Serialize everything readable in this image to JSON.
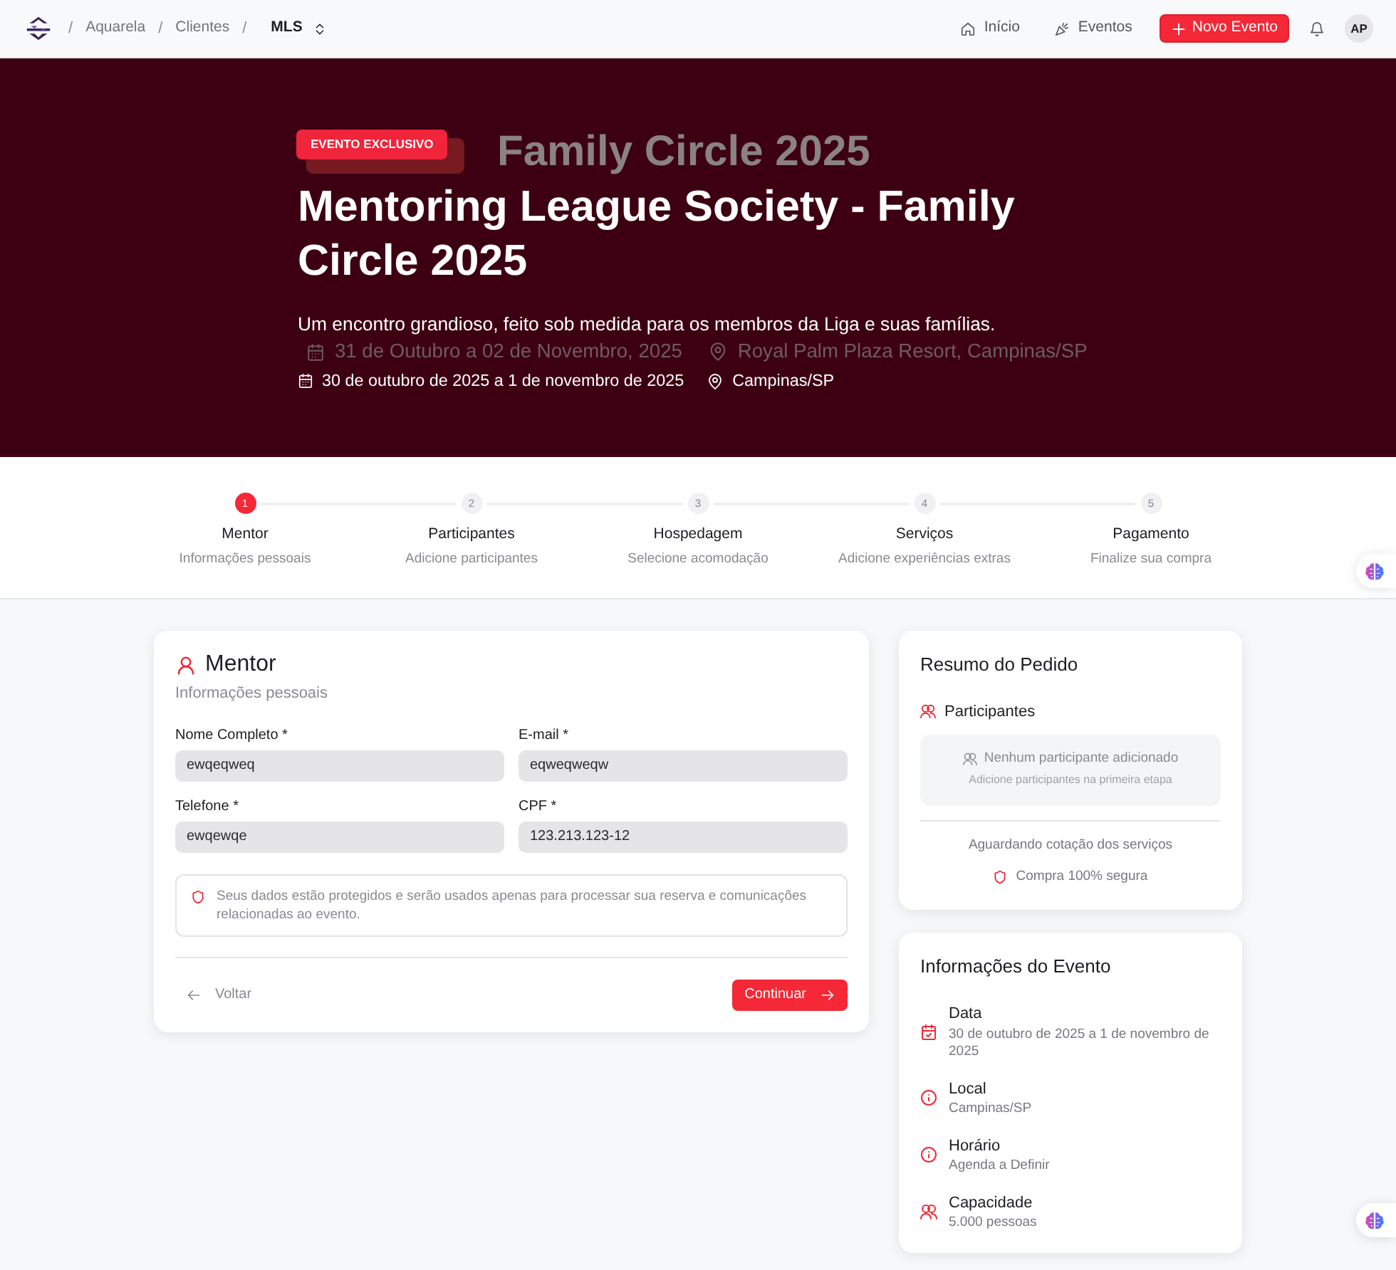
{
  "navbar": {
    "breadcrumb": [
      {
        "kind": "separator",
        "text": "/"
      },
      {
        "kind": "link",
        "text": "Aquarela"
      },
      {
        "kind": "separator",
        "text": "/"
      },
      {
        "kind": "link",
        "text": "Clientes"
      },
      {
        "kind": "separator",
        "text": "/"
      },
      {
        "kind": "current",
        "text": "MLS"
      }
    ],
    "links": [
      {
        "kind": "home",
        "label": "Início"
      },
      {
        "kind": "party",
        "label": "Eventos"
      }
    ],
    "new_button": "Novo Evento",
    "avatar": "AP"
  },
  "hero": {
    "badge": "EVENTO EXCLUSIVO",
    "title": "Mentoring League Society - Family Circle 2025",
    "subtitle": "Um encontro grandioso, feito sob medida para os membros da Liga e suas famílias.",
    "date": "30 de outubro de 2025 a 1 de novembro de 2025",
    "location": "Campinas/SP",
    "previous_slide": {
      "badge": true,
      "title": "Family Circle 2025",
      "date": "31 de Outubro a 02 de Novembro, 2025",
      "location": "Royal Palm Plaza Resort, Campinas/SP"
    }
  },
  "stepper": {
    "steps": [
      {
        "number": "1",
        "title": "Mentor",
        "subtitle": "Informações pessoais",
        "active": true
      },
      {
        "number": "2",
        "title": "Participantes",
        "subtitle": "Adicione participantes",
        "active": false
      },
      {
        "number": "3",
        "title": "Hospedagem",
        "subtitle": "Selecione acomodação",
        "active": false
      },
      {
        "number": "4",
        "title": "Serviços",
        "subtitle": "Adicione experiências extras",
        "active": false
      },
      {
        "number": "5",
        "title": "Pagamento",
        "subtitle": "Finalize sua compra",
        "active": false
      }
    ]
  },
  "form": {
    "title": "Mentor",
    "subtitle": "Informações pessoais",
    "fields": [
      {
        "label": "Nome Completo *",
        "value": "ewqeqweq"
      },
      {
        "label": "E-mail *",
        "value": "eqweqweqw"
      },
      {
        "label": "Telefone *",
        "value": "ewqewqe"
      },
      {
        "label": "CPF *",
        "value": "123.213.123-12"
      }
    ],
    "notice": "Seus dados estão protegidos e serão usados apenas para processar sua reserva e comunicações relacionadas ao evento.",
    "back_button": "Voltar",
    "continue_button": "Continuar"
  },
  "order_summary": {
    "title": "Resumo do Pedido",
    "section": "Participantes",
    "empty_title": "Nenhum participante adicionado",
    "empty_hint": "Adicione participantes na primeira etapa",
    "status": "Aguardando cotação dos serviços",
    "secure_note": "Compra 100% segura"
  },
  "event_info": {
    "title": "Informações do Evento",
    "items": [
      {
        "kind": "date",
        "label": "Data",
        "value": "30 de outubro de 2025 a 1 de novembro de 2025"
      },
      {
        "kind": "info",
        "label": "Local",
        "value": "Campinas/SP"
      },
      {
        "kind": "info",
        "label": "Horário",
        "value": "Agenda a Definir"
      },
      {
        "kind": "people",
        "label": "Capacidade",
        "value": "5.000 pessoas"
      }
    ]
  }
}
